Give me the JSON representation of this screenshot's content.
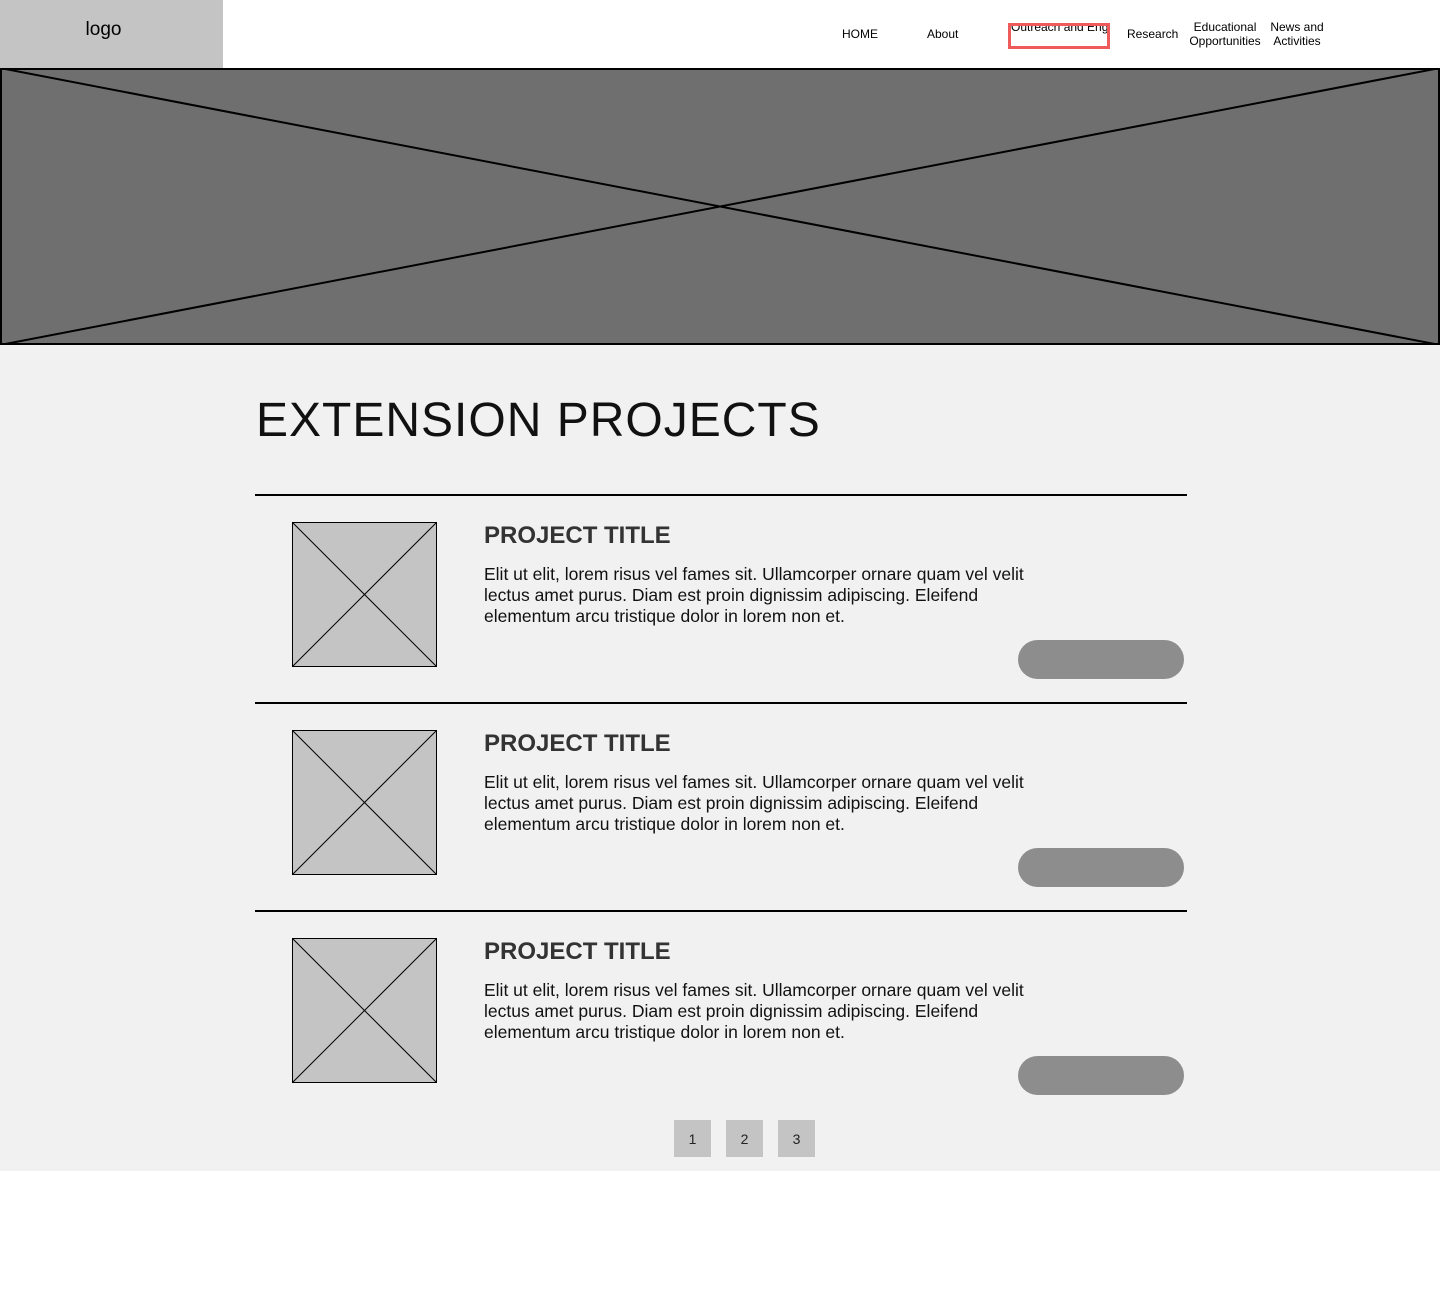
{
  "header": {
    "logo_text": "logo",
    "nav": [
      {
        "label": "HOME"
      },
      {
        "label": "About"
      },
      {
        "label": "Outreach and Engagement",
        "highlight_color": "#ef5b5b"
      },
      {
        "label": "Research"
      },
      {
        "label": "Educational Opportunities"
      },
      {
        "label": "News and Activities"
      }
    ]
  },
  "hero": {
    "image": "placeholder-image",
    "color": "#6f6f6f"
  },
  "main": {
    "title": "EXTENSION PROJECTS",
    "projects": [
      {
        "title": "PROJECT TITLE",
        "description": "Elit ut elit, lorem risus vel fames sit. Ullamcorper ornare quam vel velit lectus amet purus. Diam est proin dignissim adipiscing. Eleifend elementum arcu tristique dolor in lorem non et.",
        "button_label": ""
      },
      {
        "title": "PROJECT TITLE",
        "description": "Elit ut elit, lorem risus vel fames sit. Ullamcorper ornare quam vel velit lectus amet purus. Diam est proin dignissim adipiscing. Eleifend elementum arcu tristique dolor in lorem non et.",
        "button_label": ""
      },
      {
        "title": "PROJECT TITLE",
        "description": "Elit ut elit, lorem risus vel fames sit. Ullamcorper ornare quam vel velit lectus amet purus. Diam est proin dignissim adipiscing. Eleifend elementum arcu tristique dolor in lorem non et.",
        "button_label": ""
      }
    ],
    "pagination": [
      "1",
      "2",
      "3"
    ]
  },
  "colors": {
    "content_bg": "#f1f1f1",
    "placeholder": "#c4c4c4",
    "button": "#8d8d8d"
  }
}
